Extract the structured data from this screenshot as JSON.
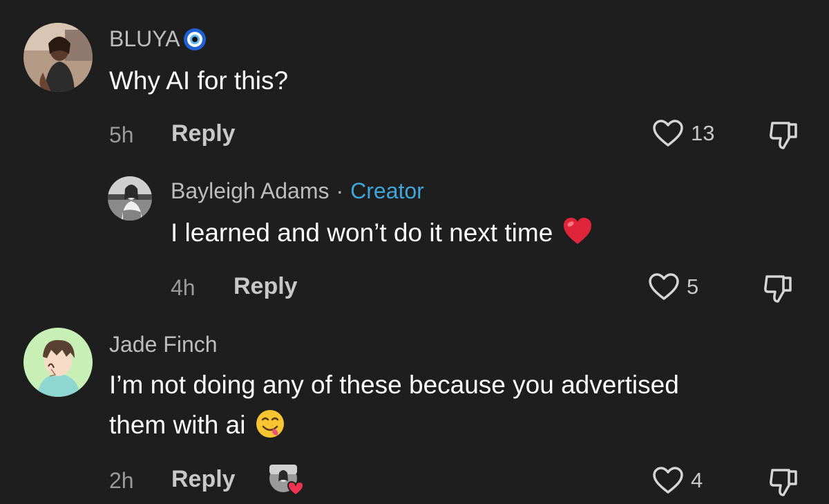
{
  "comments": [
    {
      "username": "BLUYA",
      "badge_icon": "nazar-eye-icon",
      "text": "Why AI for this?",
      "time": "5h",
      "reply_label": "Reply",
      "likes": "13"
    },
    {
      "username": "Bayleigh Adams",
      "separator": "·",
      "role": "Creator",
      "text": "I learned and won’t do it next time",
      "text_emoji": "red-heart",
      "time": "4h",
      "reply_label": "Reply",
      "likes": "5"
    },
    {
      "username": "Jade Finch",
      "text_line1": "I’m not doing any of these because you advertised",
      "text_line2": "them with ai",
      "text_emoji": "face-savoring-food",
      "time": "2h",
      "reply_label": "Reply",
      "likes": "4",
      "liked_by_creator": true
    }
  ],
  "colors": {
    "background": "#1e1e1e",
    "username": "#bdbdbd",
    "creator_accent": "#3ea6d8",
    "meta": "#9a9a9a"
  }
}
